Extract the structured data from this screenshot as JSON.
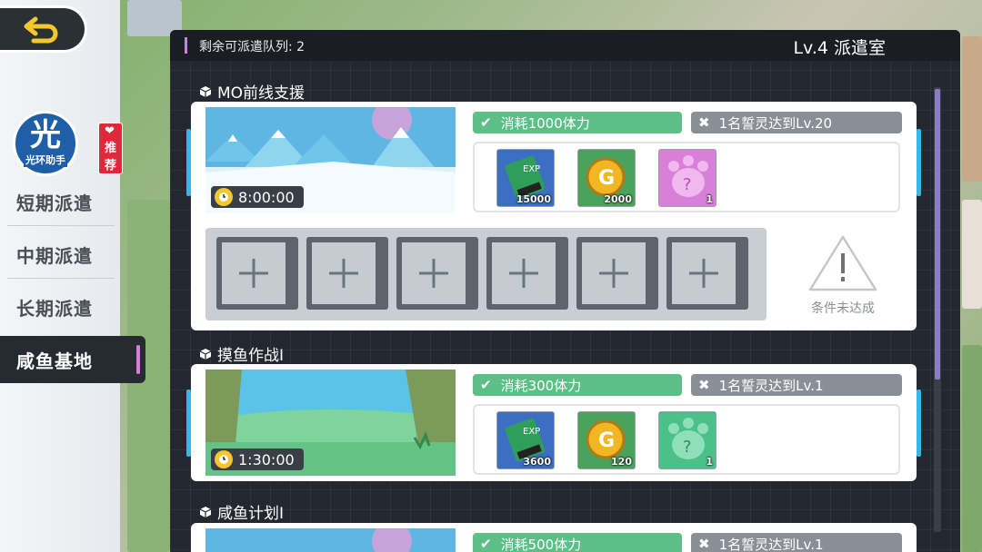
{
  "nav": {
    "logo_char": "光",
    "logo_text": "光环助手",
    "recommend_badge": "推荐",
    "items": [
      {
        "label": "短期派遣"
      },
      {
        "label": "中期派遣"
      },
      {
        "label": "长期派遣"
      },
      {
        "label": "咸鱼基地"
      }
    ],
    "active_index": 3
  },
  "header": {
    "queue_label": "剩余可派遣队列: 2",
    "room_title": "Lv.4 派遣室"
  },
  "missions": [
    {
      "title": "MO前线支援",
      "timer": "8:00:00",
      "cost": "消耗1000体力",
      "requirement": "1名誓灵达到Lv.20",
      "rewards": [
        {
          "icon": "exp-chip-icon",
          "count": "15000"
        },
        {
          "icon": "gold-coin-icon",
          "count": "2000"
        },
        {
          "icon": "mystery-paw-purple-icon",
          "count": "1"
        }
      ],
      "warning": "条件未达成"
    },
    {
      "title": "摸鱼作战I",
      "timer": "1:30:00",
      "cost": "消耗300体力",
      "requirement": "1名誓灵达到Lv.1",
      "rewards": [
        {
          "icon": "exp-chip-icon",
          "count": "3600"
        },
        {
          "icon": "gold-coin-icon",
          "count": "120"
        },
        {
          "icon": "mystery-paw-green-icon",
          "count": "1"
        }
      ]
    },
    {
      "title": "咸鱼计划I",
      "cost": "消耗500体力",
      "requirement": "1名誓灵达到Lv.1"
    }
  ],
  "colors": {
    "accent": "#d87bd9",
    "ok": "#5cbf85",
    "no": "#8a8f97",
    "panel": "#23272f"
  }
}
